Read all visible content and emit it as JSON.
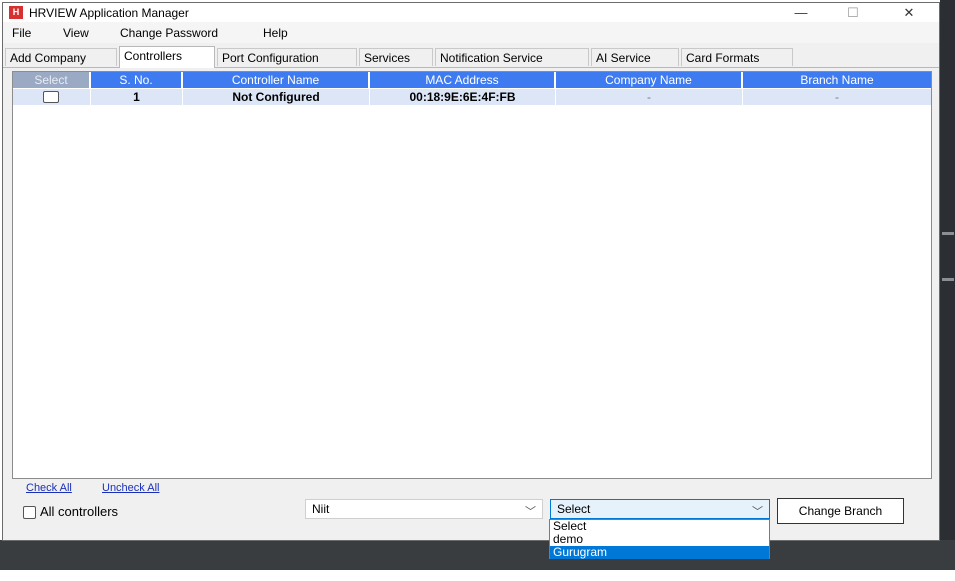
{
  "window": {
    "title": "HRVIEW Application Manager",
    "controls": {
      "minimize": "—",
      "maximize": "☐",
      "close": "✕"
    }
  },
  "menu": [
    "File",
    "View",
    "Change Password",
    "Help"
  ],
  "tabs": [
    {
      "label": "Add Company",
      "active": false
    },
    {
      "label": "Controllers",
      "active": true
    },
    {
      "label": "Port Configuration",
      "active": false
    },
    {
      "label": "Services",
      "active": false
    },
    {
      "label": "Notification Service",
      "active": false
    },
    {
      "label": "AI Service",
      "active": false
    },
    {
      "label": "Card Formats",
      "active": false
    }
  ],
  "grid": {
    "columns": [
      "Select",
      "S. No.",
      "Controller Name",
      "MAC Address",
      "Company Name",
      "Branch Name"
    ],
    "rows": [
      {
        "checked": false,
        "sno": "1",
        "controller_name": "Not Configured",
        "mac": "00:18:9E:6E:4F:FB",
        "company": "-",
        "branch": "-"
      }
    ]
  },
  "links": {
    "check_all": "Check All",
    "uncheck_all": "Uncheck All"
  },
  "all_controllers": {
    "label": "All controllers",
    "checked": false
  },
  "company_combo": {
    "value": "Niit"
  },
  "branch_combo": {
    "value": "Select",
    "options": [
      "Select",
      "demo",
      "Gurugram"
    ],
    "highlighted": "Gurugram"
  },
  "change_branch_button": "Change Branch",
  "colors": {
    "header_blue": "#3e7bf0",
    "row_bg": "#dce6f7",
    "selection_blue": "#0078d7"
  }
}
